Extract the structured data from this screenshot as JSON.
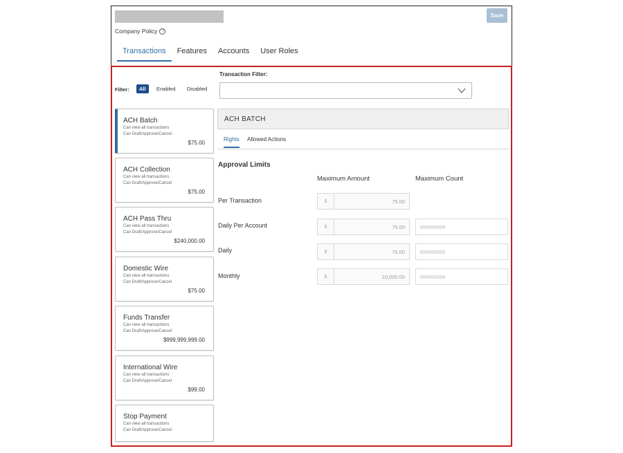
{
  "header": {
    "save_label": "Save",
    "policy_label": "Company Policy",
    "help_icon": "?",
    "tabs": [
      "Transactions",
      "Features",
      "Accounts",
      "User Roles"
    ]
  },
  "filter": {
    "label": "Filter:",
    "options": [
      "All",
      "Enabled",
      "Disabled"
    ],
    "selected": "All"
  },
  "transaction_filter": {
    "label": "Transaction Filter:",
    "value": ""
  },
  "cards": [
    {
      "title": "ACH Batch",
      "line1": "Can view all transactions",
      "line2": "Can Draft/Approve/Cancel",
      "amount": "$75.00"
    },
    {
      "title": "ACH Collection",
      "line1": "Can view all transactions",
      "line2": "Can Draft/Approve/Cancel",
      "amount": "$75.00"
    },
    {
      "title": "ACH Pass Thru",
      "line1": "Can view all transactions",
      "line2": "Can Draft/Approve/Cancel",
      "amount": "$240,000.00"
    },
    {
      "title": "Domestic Wire",
      "line1": "Can view all transactions",
      "line2": "Can Draft/Approve/Cancel",
      "amount": "$75.00"
    },
    {
      "title": "Funds Transfer",
      "line1": "Can view all transactions",
      "line2": "Can Draft/Approve/Cancel",
      "amount": "$999,999,999.00"
    },
    {
      "title": "International Wire",
      "line1": "Can view all transactions",
      "line2": "Can Draft/Approve/Cancel",
      "amount": "$99.00"
    },
    {
      "title": "Stop Payment",
      "line1": "Can view all transactions",
      "line2": "Can Draft/Approve/Cancel",
      "amount": ""
    }
  ],
  "detail": {
    "title": "ACH BATCH",
    "tabs": [
      "Rights",
      "Allowed Actions"
    ],
    "approval_title": "Approval Limits",
    "col_max_amount": "Maximum Amount",
    "col_max_count": "Maximum Count",
    "currency_symbol": "$",
    "rows": [
      {
        "label": "Per Transaction",
        "amount": "75.00",
        "count": ""
      },
      {
        "label": "Daily Per Account",
        "amount": "75.00",
        "count": "999999999"
      },
      {
        "label": "Daily",
        "amount": "75.00",
        "count": "999999999"
      },
      {
        "label": "Monthly",
        "amount": "10,000.00",
        "count": "999999999"
      }
    ]
  },
  "colors": {
    "accent": "#2f6da3",
    "filter_all_bg": "#1d4e89",
    "highlight_border": "#c81e1e",
    "save_button": "#a9bfd3"
  }
}
